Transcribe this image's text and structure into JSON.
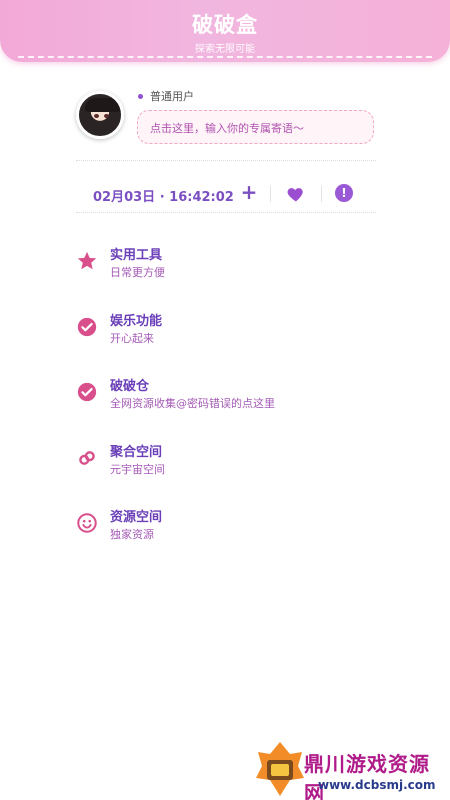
{
  "header": {
    "title": "破破盒",
    "subtitle": "探索无限可能"
  },
  "profile": {
    "user_type": "普通用户",
    "motto_placeholder": "点击这里，输入你的专属寄语～"
  },
  "date_bar": {
    "datetime": "02月03日 · 16:42:02",
    "plus_icon": "plus-icon",
    "heart_icon": "heart-icon",
    "info_icon": "exclamation-circle-icon"
  },
  "menu": {
    "items": [
      {
        "title": "实用工具",
        "subtitle": "日常更方便",
        "icon": "star-icon"
      },
      {
        "title": "娱乐功能",
        "subtitle": "开心起来",
        "icon": "check-circle-icon"
      },
      {
        "title": "破破仓",
        "subtitle": "全网资源收集@密码错误的点这里",
        "icon": "check-circle-icon"
      },
      {
        "title": "聚合空间",
        "subtitle": "元宇宙空间",
        "icon": "link-icon"
      },
      {
        "title": "资源空间",
        "subtitle": "独家资源",
        "icon": "smile-icon"
      }
    ]
  },
  "watermark": {
    "title": "鼎川游戏资源网",
    "url": "www.dcbsmj.com"
  },
  "colors": {
    "accent_purple": "#7a4fc2",
    "accent_pink": "#d94f8c",
    "header_pink": "#f3a9d8"
  }
}
